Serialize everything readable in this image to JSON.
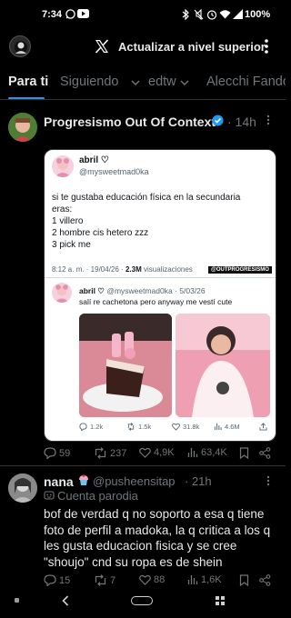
{
  "status_bar": {
    "time": "7:34",
    "battery": "100%"
  },
  "header": {
    "title": "Actualizar a nivel superior"
  },
  "tabs": [
    {
      "label": "Para ti"
    },
    {
      "label": "Siguiendo"
    },
    {
      "label": "edtw"
    },
    {
      "label": "Alecchi Fando"
    }
  ],
  "tweet1": {
    "author": "Progresismo Out Of Context",
    "time": "· 14h",
    "screenshot": {
      "name": "abril ♡",
      "handle": "@mysweetmad0ka",
      "text_lines": [
        "si te gustaba educación física en la secundaria",
        "eras:",
        "1 villero",
        "2 hombre cis hetero zzz",
        "3 pick me"
      ],
      "meta": "8:12 a. m. · 19/04/26 ·",
      "views": "2.3M",
      "views_label": "visualizaciones",
      "watermark": "@OUTPROGRESISMO",
      "quote": {
        "name": "abril ♡",
        "handle": "@mysweetmad0ka · 5/03/26",
        "text": "salí re cachetona pero anyway me vestí cute"
      },
      "stats": {
        "replies": "1.2k",
        "reposts": "1.5k",
        "likes": "31.8k",
        "views": "4.6M"
      }
    },
    "actions": {
      "replies": "59",
      "reposts": "237",
      "likes": "4,9K",
      "views": "63,4K"
    }
  },
  "tweet2": {
    "author": "nana",
    "handle": "@pusheensitap",
    "time": "· 21h",
    "badge": "Cuenta parodia",
    "text_lines": [
      "bof de verdad q no soporto a esa q tiene",
      "foto de perfil a madoka, la q critica a los q",
      "les gusta educacion fisica y se cree",
      "\"shoujo\" cnd su ropa es de shein"
    ],
    "actions": {
      "replies": "15",
      "reposts": "7",
      "likes": "88",
      "views": "1,6K"
    }
  },
  "colors": {
    "accent": "#1d9bf0",
    "background": "#000000",
    "muted": "#71767b"
  }
}
